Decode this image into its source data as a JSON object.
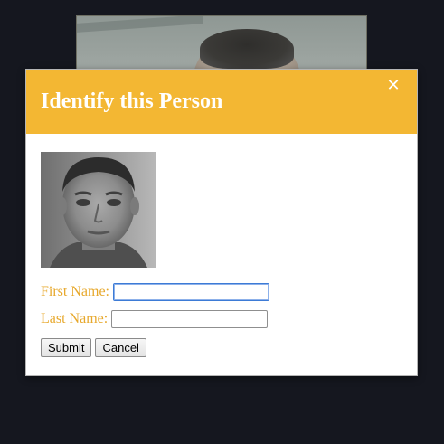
{
  "modal": {
    "title": "Identify this Person",
    "close_icon": "close-icon",
    "close_glyph": "✕"
  },
  "form": {
    "first_name_label": "First Name:",
    "first_name_value": "",
    "last_name_label": "Last Name:",
    "last_name_value": "",
    "submit_label": "Submit",
    "cancel_label": "Cancel"
  },
  "colors": {
    "header": "#f3b733",
    "label": "#e7a82c",
    "page_background": "#15171f"
  }
}
